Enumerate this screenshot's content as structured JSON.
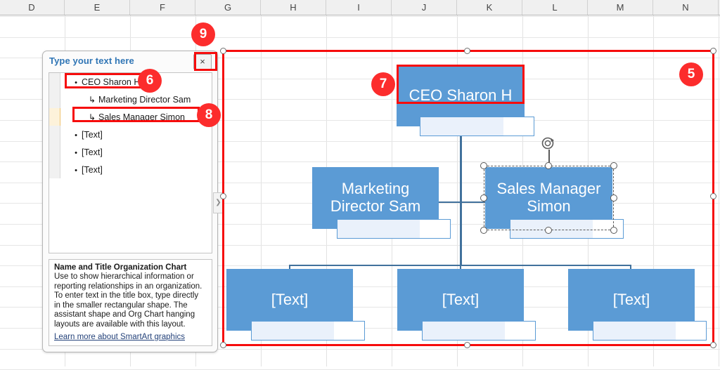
{
  "spreadsheet": {
    "columns": [
      "D",
      "E",
      "F",
      "G",
      "H",
      "I",
      "J",
      "K",
      "L",
      "M",
      "N"
    ]
  },
  "text_pane": {
    "title": "Type your text here",
    "close_label": "×",
    "items": [
      {
        "level": 1,
        "marker": "•",
        "text": "CEO Sharon H",
        "selected": false
      },
      {
        "level": 2,
        "marker": "↳",
        "text": "Marketing Director Sam",
        "selected": false
      },
      {
        "level": 2,
        "marker": "↳",
        "text": "Sales Manager Simon",
        "selected": true
      },
      {
        "level": 1,
        "marker": "•",
        "text": "[Text]",
        "selected": false
      },
      {
        "level": 1,
        "marker": "•",
        "text": "[Text]",
        "selected": false
      },
      {
        "level": 1,
        "marker": "•",
        "text": "[Text]",
        "selected": false
      }
    ],
    "description": {
      "title": "Name and Title Organization Chart",
      "body": "Use to show hierarchical information or reporting relationships in an organization. To enter text in the title box, type directly in the smaller rectangular shape. The assistant shape and Org Chart hanging layouts are available with this layout.",
      "link": "Learn more about SmartArt graphics"
    }
  },
  "smartart": {
    "nodes": [
      {
        "id": "ceo",
        "label": "CEO Sharon H"
      },
      {
        "id": "marketing",
        "label": "Marketing Director Sam"
      },
      {
        "id": "sales",
        "label": "Sales Manager Simon"
      },
      {
        "id": "text1",
        "label": "[Text]"
      },
      {
        "id": "text2",
        "label": "[Text]"
      },
      {
        "id": "text3",
        "label": "[Text]"
      }
    ]
  },
  "annotations": {
    "badges": [
      {
        "id": "b5",
        "label": "5"
      },
      {
        "id": "b6",
        "label": "6"
      },
      {
        "id": "b7",
        "label": "7"
      },
      {
        "id": "b8",
        "label": "8"
      },
      {
        "id": "b9",
        "label": "9"
      }
    ]
  },
  "colors": {
    "node_fill": "#5b9bd5",
    "connector": "#41719c",
    "annotation_red": "#f60c0c",
    "badge_red": "#fc2c2c",
    "pane_title_blue": "#2f75b5",
    "selected_row": "#fdf2da"
  }
}
